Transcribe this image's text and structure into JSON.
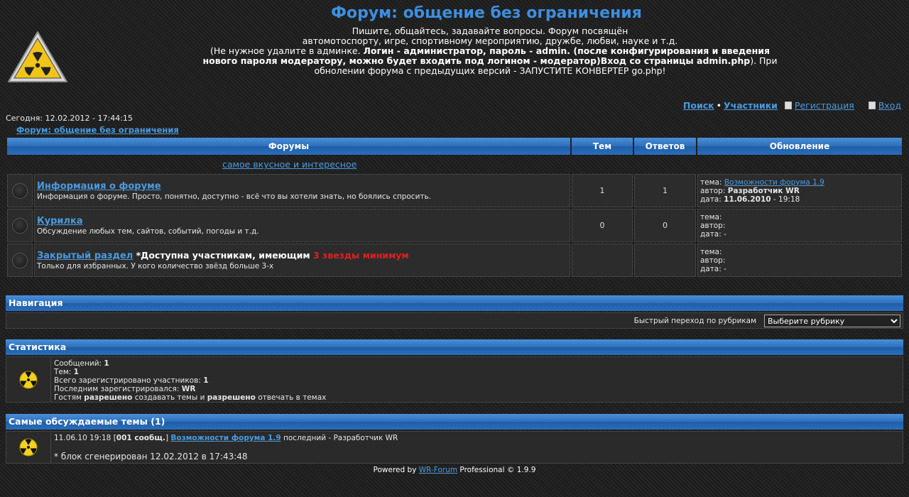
{
  "header": {
    "title": "Форум: общение без ограничения",
    "desc_line1": "Пишите, общайтесь, задавайте вопросы. Форум посвящён",
    "desc_line2": "автомотоспорту, игре, спортивному мероприятию, дружбе, любви, науке и т.д.",
    "desc_line3a": "(Не нужное удалите в админке. ",
    "desc_line3b": "Логин - администратор, пароль - admin. (после конфигурирования и введения нового пароля модератору, можно будет входить под логином - модератор)Вход со страницы admin.php",
    "desc_line3c": "). При обнолении форума с предыдущих версий - ЗАПУСТИТЕ КОНВЕРТЕР go.php!"
  },
  "topnav": {
    "search": "Поиск",
    "members": "Участники",
    "register": "Регистрация",
    "login": "Вход"
  },
  "today": "Сегодня: 12.02.2012 - 17:44:15",
  "breadcrumb": "Форум: общение без ограничения",
  "table": {
    "headers": [
      "Форумы",
      "Тем",
      "Ответов",
      "Обновление"
    ],
    "category": "самое вкусное и интересное",
    "rows": [
      {
        "name": "Информация о форуме",
        "desc": "Информация о форуме. Просто, понятно, доступно - всё что вы хотели знать, но боялись спросить.",
        "topics": "1",
        "replies": "1",
        "upd_topic_label": "тема:",
        "upd_topic": "Возможности форума 1.9",
        "upd_author_label": "автор:",
        "upd_author": "Разработчик WR",
        "upd_date_label": "дата:",
        "upd_date_bold": "11.06.2010",
        "upd_date_rest": " - 19:18"
      },
      {
        "name": "Курилка",
        "desc": "Обсуждение любых тем, сайтов, событий, погоды и т.д.",
        "topics": "0",
        "replies": "0",
        "upd_topic_label": "тема:",
        "upd_author_label": "автор:",
        "upd_date_label": "дата: -"
      },
      {
        "name": "Закрытый раздел",
        "note": " *Доступна участникам, имеющим ",
        "note_red": "3 звезды минимум",
        "desc": "Только для избранных. У кого количество звёзд больше 3-х",
        "upd_topic_label": "тема:",
        "upd_author_label": "автор:",
        "upd_date_label": "дата: -"
      }
    ]
  },
  "navigation": {
    "title": "Навигация",
    "quick_label": "Быстрый переход по рубрикам",
    "select_value": "Выберите рубрику"
  },
  "stats": {
    "title": "Статистика",
    "messages_label": "Сообщений: ",
    "messages": "1",
    "topics_label": "Тем: ",
    "topics": "1",
    "users_label": "Всего зарегистрировано участников: ",
    "users": "1",
    "last_label": "Последним зарегистрировался: ",
    "last": "WR",
    "guests_a": "Гостям ",
    "guests_b": "разрешено",
    "guests_c": " создавать темы и ",
    "guests_d": "разрешено",
    "guests_e": " отвечать в темах"
  },
  "hot": {
    "title": "Самые обсуждаемые темы (1)",
    "date": "11.06.10 19:18 [",
    "count": "001 сообщ.",
    "close": "] ",
    "topic": "Возможности форума 1.9",
    "last": " последний - Разработчик WR",
    "generated": "* блок сгенерирован 12.02.2012 в 17:43:48"
  },
  "footer": {
    "prefix": "Powered by ",
    "link": "WR-Forum",
    "suffix": " Professional © 1.9.9"
  },
  "colors": {
    "accent": "#3d8fe0",
    "link": "#4a9be0",
    "warning": "#e02020"
  },
  "icons": [
    "radiation-sign-icon",
    "radiation-icon",
    "forum-status-icon",
    "register-icon",
    "login-icon",
    "dropdown-arrow-icon"
  ]
}
